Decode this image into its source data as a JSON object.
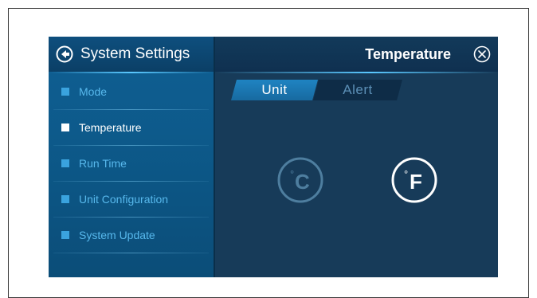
{
  "sidebar": {
    "header_title": "System Settings",
    "items": [
      {
        "label": "Mode",
        "active": false
      },
      {
        "label": "Temperature",
        "active": true
      },
      {
        "label": "Run Time",
        "active": false
      },
      {
        "label": "Unit Configuration",
        "active": false
      },
      {
        "label": "System Update",
        "active": false
      }
    ]
  },
  "main": {
    "title": "Temperature",
    "tabs": [
      {
        "label": "Unit",
        "selected": true
      },
      {
        "label": "Alert",
        "selected": false
      }
    ],
    "unit_options": [
      {
        "symbol": "°",
        "letter": "C",
        "selected": false,
        "icon": "celsius-icon"
      },
      {
        "symbol": "°",
        "letter": "F",
        "selected": true,
        "icon": "fahrenheit-icon"
      }
    ]
  },
  "colors": {
    "screen_bg": "#173b59",
    "sidebar_bg": "#0f5f93",
    "accent_glow": "#5ac8ff",
    "inactive_text": "#57b8ec",
    "active_text": "#ffffff",
    "tab_selected": "#1f84c2",
    "tab_unselected": "#0e2c47",
    "unit_unselected": "#4e7e9f"
  }
}
